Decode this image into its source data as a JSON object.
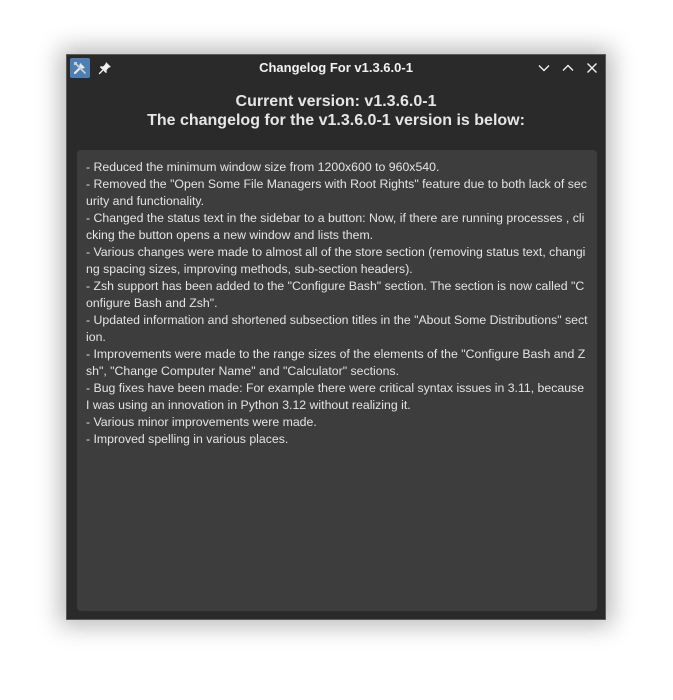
{
  "window": {
    "title": "Changelog For v1.3.6.0-1"
  },
  "header": {
    "current_version": "Current version: v1.3.6.0-1",
    "changelog_intro": "The changelog for the v1.3.6.0-1 version is below:"
  },
  "changelog": [
    "-  Reduced the minimum window size from 1200x600 to 960x540.",
    "-  Removed the \"Open Some File Managers with Root Rights\" feature due to both lack of security and functionality.",
    "-  Changed the status text in the sidebar to a button: Now, if there are running processes , clicking the button opens a new window and lists them.",
    "-  Various changes were made to almost all of the store section (removing status text, changing spacing sizes, improving methods, sub-section headers).",
    "-  Zsh support has been added to the \"Configure Bash\" section. The section is now called \"Configure Bash and Zsh\".",
    "-  Updated information and shortened subsection titles in the \"About Some Distributions\" section.",
    "-  Improvements were made to the range sizes of the elements of the \"Configure Bash and Zsh\", \"Change Computer Name\" and \"Calculator\" sections.",
    "-  Bug fixes have been made: For example there were critical syntax issues in 3.11, because I was using an innovation in Python 3.12 without realizing it.",
    "-  Various minor improvements were made.",
    "-  Improved spelling in various places."
  ],
  "icons": {
    "app": "tools-icon",
    "pin": "pin-icon",
    "minimize": "chevron-down-icon",
    "maximize": "chevron-up-icon",
    "close": "close-icon"
  },
  "colors": {
    "window_bg": "#2a2a2a",
    "text_area_bg": "#3d3d3d",
    "app_icon_bg": "#4d7fb5",
    "text": "#e4e4e4"
  }
}
